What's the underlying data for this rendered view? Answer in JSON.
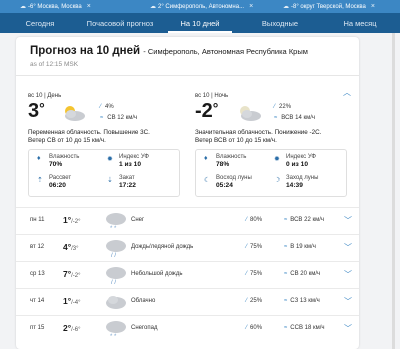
{
  "browser_tabs": [
    {
      "icon": "weather-icon",
      "label": "-6° Москва, Москва"
    },
    {
      "icon": "weather-icon",
      "label": "2° Симферополь, Автономна..."
    },
    {
      "icon": "weather-icon",
      "label": "-8° округ Тверской, Москва"
    }
  ],
  "nav": {
    "tabs": [
      "Сегодня",
      "Почасовой прогноз",
      "На 10 дней",
      "Выходные",
      "На месяц"
    ],
    "active": "На 10 дней"
  },
  "header": {
    "title": "Прогноз на 10 дней",
    "location": "- Симферополь, Автономная Республика Крым",
    "as_of": "as of 12:15 MSK"
  },
  "day": {
    "label": "вс 10 | День",
    "temp": "3",
    "deg": "°",
    "precip": "4%",
    "wind": "СВ 12 км/ч",
    "desc_line1": "Переменная облачность. Повышение 3С.",
    "desc_line2": "Ветер СВ от 10 до 15 км/ч.",
    "humidity_label": "Влажность",
    "humidity": "70%",
    "uv_label": "Индекс УФ",
    "uv": "1 из 10",
    "sunrise_label": "Рассвет",
    "sunrise": "06:20",
    "sunset_label": "Закат",
    "sunset": "17:22"
  },
  "night": {
    "label": "вс 10 | Ночь",
    "temp": "-2",
    "deg": "°",
    "precip": "22%",
    "wind": "ВСВ 14 км/ч",
    "desc_line1": "Значительная облачность. Понижение -2С.",
    "desc_line2": "Ветер ВСВ от 10 до 15 км/ч.",
    "humidity_label": "Влажность",
    "humidity": "78%",
    "uv_label": "Индекс УФ",
    "uv": "0 из 10",
    "moonrise_label": "Восход луны",
    "moonrise": "05:24",
    "moonset_label": "Заход луны",
    "moonset": "14:39"
  },
  "rows": [
    {
      "day": "пн 11",
      "hi": "1°",
      "lo": "/-2°",
      "cond": "Снег",
      "precip": "80%",
      "wind": "ВСВ 22 км/ч",
      "icon": "snow-icon"
    },
    {
      "day": "вт 12",
      "hi": "4°",
      "lo": "/3°",
      "cond": "Дождь/ледяной дождь",
      "precip": "75%",
      "wind": "В 19 км/ч",
      "icon": "rain-icon"
    },
    {
      "day": "ср 13",
      "hi": "7°",
      "lo": "/-2°",
      "cond": "Небольшой дождь",
      "precip": "75%",
      "wind": "СВ 20 км/ч",
      "icon": "rain-icon"
    },
    {
      "day": "чт 14",
      "hi": "1°",
      "lo": "/-4°",
      "cond": "Облачно",
      "precip": "25%",
      "wind": "СЗ 13 км/ч",
      "icon": "cloud-icon"
    },
    {
      "day": "пт 15",
      "hi": "2°",
      "lo": "/-6°",
      "cond": "Снегопад",
      "precip": "60%",
      "wind": "ССВ 18 км/ч",
      "icon": "snow-icon"
    }
  ]
}
